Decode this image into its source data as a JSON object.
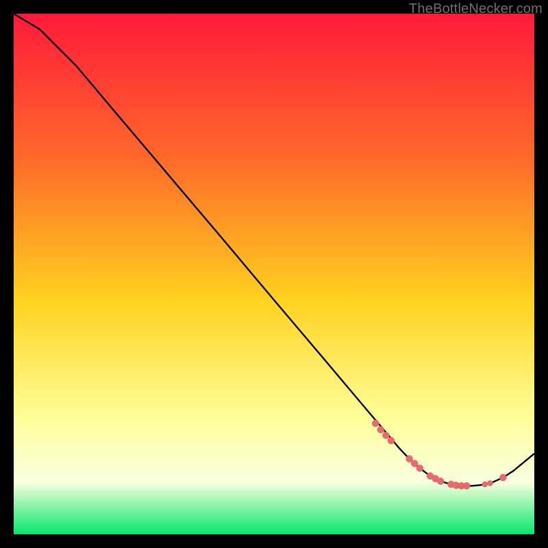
{
  "watermark": "TheBottleNecker.com",
  "colors": {
    "bg": "#000000",
    "gradient_top": "#ff1a3a",
    "gradient_mid_upper": "#ff6a2a",
    "gradient_mid": "#ffd21f",
    "gradient_soft_yellow": "#ffff9a",
    "gradient_pale": "#f8ffe0",
    "gradient_bottom": "#06e56a",
    "curve": "#000000",
    "marker_fill": "#e86a6e",
    "marker_stroke": "#d95a60"
  },
  "chart_data": {
    "type": "line",
    "title": "",
    "xlabel": "",
    "ylabel": "",
    "xlim": [
      0,
      100
    ],
    "ylim": [
      0,
      100
    ],
    "series": [
      {
        "name": "bottleneck-curve",
        "x": [
          0,
          5,
          7,
          12,
          20,
          30,
          40,
          50,
          60,
          68,
          72,
          74,
          76,
          78,
          80,
          82,
          84,
          86,
          88,
          90,
          92,
          94,
          96,
          100
        ],
        "y": [
          100,
          97,
          95,
          90,
          80.5,
          68.7,
          56.9,
          45.0,
          33.2,
          23.7,
          19.0,
          16.6,
          14.5,
          12.7,
          11.2,
          10.2,
          9.6,
          9.3,
          9.3,
          9.5,
          10.0,
          10.9,
          12.2,
          15.5
        ]
      }
    ],
    "markers": {
      "name": "highlighted-points",
      "x": [
        69.5,
        70.5,
        71.5,
        72.5,
        76,
        77,
        78,
        80,
        81,
        82,
        84,
        85,
        86,
        87,
        90.5,
        91.5,
        94
      ],
      "y": [
        21.3,
        20.1,
        19.0,
        18.0,
        14.5,
        13.6,
        12.7,
        11.2,
        10.7,
        10.2,
        9.6,
        9.4,
        9.3,
        9.3,
        9.6,
        9.8,
        10.9
      ],
      "r": [
        5,
        5,
        5,
        5,
        5,
        5,
        5,
        5,
        5,
        5,
        5,
        5,
        5,
        5,
        4,
        4,
        5
      ]
    }
  }
}
